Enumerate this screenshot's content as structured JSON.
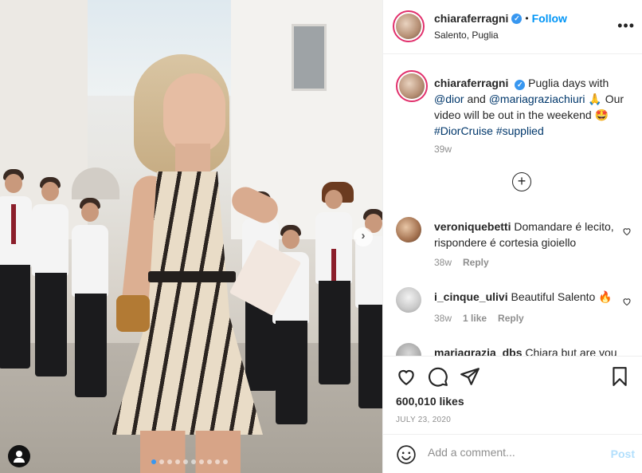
{
  "header": {
    "username": "chiaraferragni",
    "verified_icon": "verified-badge-icon",
    "separator": "•",
    "follow_label": "Follow",
    "location": "Salento, Puglia",
    "more_label": "•••"
  },
  "caption": {
    "username": "chiaraferragni",
    "text_1": "Puglia days with ",
    "mention_1": "@dior",
    "text_2": " and ",
    "mention_2": "@mariagraziachiuri",
    "text_3": " 🙏 Our video will be out in the weekend 🤩",
    "hashtag_1": "#DiorCruise",
    "hashtag_2": "#supplied",
    "time": "39w"
  },
  "load_more": {
    "icon": "plus-circle-icon",
    "label": "+"
  },
  "comments": [
    {
      "username": "veroniquebetti",
      "text": "Domandare é lecito, rispondere é cortesia gioiello",
      "time": "38w",
      "likes": "",
      "reply": "Reply"
    },
    {
      "username": "i_cinque_ulivi",
      "text": "Beautiful Salento 🔥",
      "time": "38w",
      "likes": "1 like",
      "reply": "Reply"
    },
    {
      "username": "mariagrazia_dbs",
      "text": "Chiara but are you"
    }
  ],
  "actions": {
    "like_icon": "heart-icon",
    "comment_icon": "comment-icon",
    "share_icon": "share-icon",
    "save_icon": "bookmark-icon",
    "likes_count": "600,010 likes",
    "date": "JULY 23, 2020"
  },
  "add_comment": {
    "emoji_icon": "emoji-icon",
    "placeholder": "Add a comment...",
    "post_label": "Post"
  },
  "carousel": {
    "next_label": "›",
    "slide_count": 10,
    "active_index": 0
  },
  "colors": {
    "follow": "#0095f6",
    "verified": "#3897f0",
    "post_disabled": "#b2dffc",
    "muted": "#8e8e8e"
  }
}
